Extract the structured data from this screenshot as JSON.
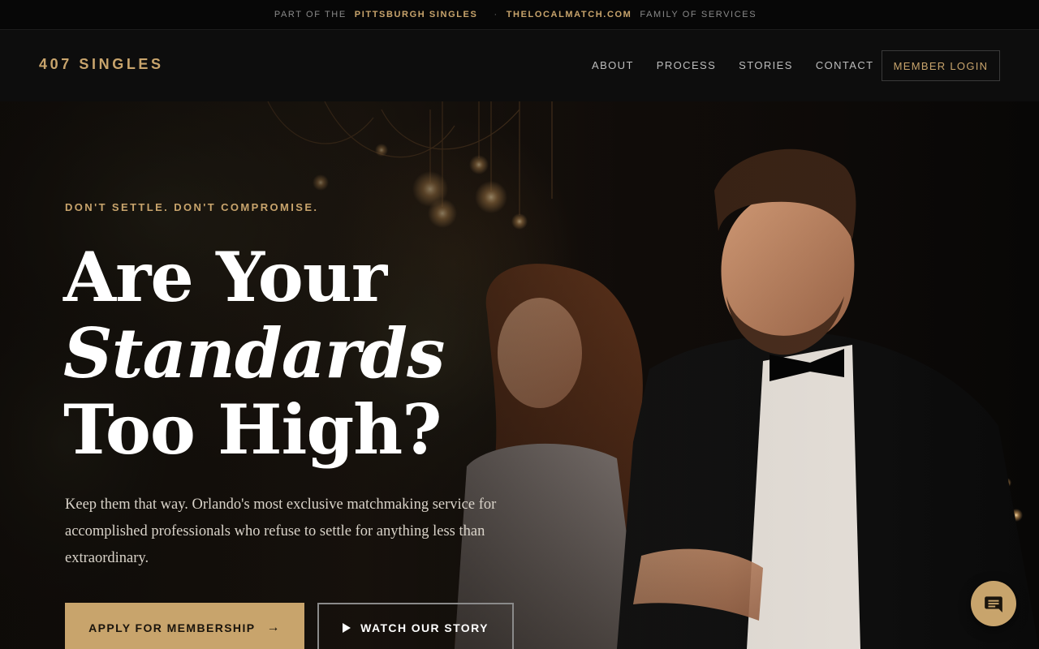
{
  "topbar": {
    "prefix": "PART OF THE",
    "brand": "PITTSBURGH SINGLES",
    "separator": "·",
    "site": "THELOCALMATCH.COM",
    "suffix": "FAMILY OF SERVICES"
  },
  "header": {
    "logo": "407 SINGLES",
    "nav": [
      "ABOUT",
      "PROCESS",
      "STORIES",
      "CONTACT"
    ],
    "login_label": "MEMBER LOGIN"
  },
  "hero": {
    "eyebrow": "DON'T SETTLE. DON'T COMPROMISE.",
    "headline_line1": "Are Your",
    "headline_em": "Standards",
    "headline_line3": "Too High?",
    "lede": "Keep them that way. Orlando's most exclusive matchmaking service for accomplished professionals who refuse to settle for anything less than extraordinary.",
    "apply_label": "APPLY FOR MEMBERSHIP",
    "apply_arrow": "→",
    "watch_label": "WATCH OUR STORY"
  },
  "icons": {
    "chat": "chat-bubble-icon",
    "play": "play-icon",
    "arrow": "arrow-right-icon"
  },
  "colors": {
    "accent": "#c8a46c",
    "background": "#0b0b0b"
  }
}
